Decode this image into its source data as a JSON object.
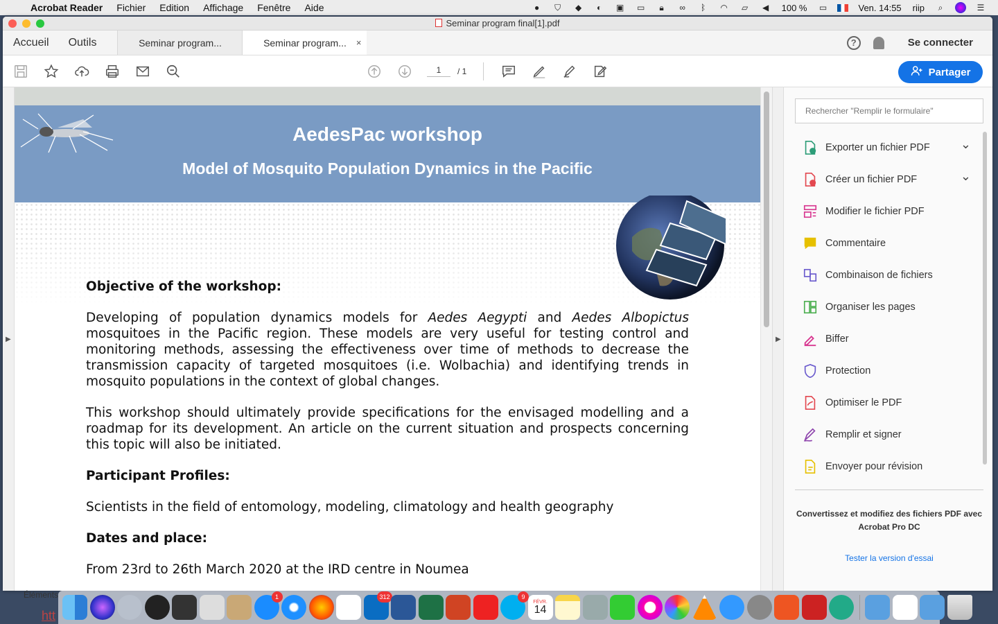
{
  "menubar": {
    "app": "Acrobat Reader",
    "items": [
      "Fichier",
      "Edition",
      "Affichage",
      "Fenêtre",
      "Aide"
    ],
    "battery": "100 %",
    "clock": "Ven. 14:55",
    "user": "riip"
  },
  "window": {
    "title": "Seminar program final[1].pdf"
  },
  "tabs": {
    "home": "Accueil",
    "tools": "Outils",
    "doc_tabs": [
      "Seminar program...",
      "Seminar program..."
    ],
    "close": "×",
    "help": "?",
    "signin": "Se connecter"
  },
  "toolbar": {
    "page_current": "1",
    "page_total": "/ 1",
    "share_label": "Partager"
  },
  "document": {
    "banner_title": "AedesPac workshop",
    "banner_subtitle": "Model of Mosquito Population Dynamics in the Pacific",
    "h_objective": "Objective of the workshop:",
    "p1_a": "Developing of population dynamics models for ",
    "p1_b": "Aedes Aegypti",
    "p1_c": " and ",
    "p1_d": "Aedes Albopictus",
    "p1_e": " mosquitoes in the Pacific region. These models are very useful for testing control and monitoring methods, assessing the effectiveness over time of methods to decrease the transmission capacity of targeted mosquitoes (i.e. Wolbachia) and identifying trends in mosquito populations in the context of global changes.",
    "p2": "This workshop should ultimately provide specifications for the envisaged modelling and a roadmap for its development. An article on the current situation and prospects concerning this topic will also be initiated.",
    "h_profiles": "Participant Profiles:",
    "p3": "Scientists in the field of entomology, modeling, climatology and health geography",
    "h_dates": "Dates and place:",
    "p4": "From 23rd to 26th March 2020 at the IRD centre in Noumea"
  },
  "right_panel": {
    "search_placeholder": "Rechercher \"Remplir le formulaire\"",
    "tools": [
      {
        "label": "Exporter un fichier PDF",
        "icon": "export-pdf-icon",
        "color": "#2d9d78"
      },
      {
        "label": "Créer un fichier PDF",
        "icon": "create-pdf-icon",
        "color": "#e34850"
      },
      {
        "label": "Modifier le fichier PDF",
        "icon": "edit-pdf-icon",
        "color": "#d83790"
      },
      {
        "label": "Commentaire",
        "icon": "comment-icon",
        "color": "#e6c000"
      },
      {
        "label": "Combinaison de fichiers",
        "icon": "combine-files-icon",
        "color": "#6a5acd"
      },
      {
        "label": "Organiser les pages",
        "icon": "organize-pages-icon",
        "color": "#4caf50"
      },
      {
        "label": "Biffer",
        "icon": "redact-icon",
        "color": "#d83790"
      },
      {
        "label": "Protection",
        "icon": "protect-icon",
        "color": "#6a5acd"
      },
      {
        "label": "Optimiser le PDF",
        "icon": "optimize-pdf-icon",
        "color": "#e34850"
      },
      {
        "label": "Remplir et signer",
        "icon": "fill-sign-icon",
        "color": "#8e44ad"
      },
      {
        "label": "Envoyer pour révision",
        "icon": "send-review-icon",
        "color": "#e6c000"
      }
    ],
    "promo": "Convertissez et modifiez des fichiers PDF avec Acrobat Pro DC",
    "trial_link": "Tester la version d'essai"
  },
  "dock": {
    "badges": {
      "appstore": "1",
      "outlook": "312",
      "skype": "9"
    },
    "calendar_month": "FÉVR.",
    "calendar_day": "14"
  },
  "background": {
    "finder_label": "Éléments",
    "link_fragment": "htt"
  }
}
